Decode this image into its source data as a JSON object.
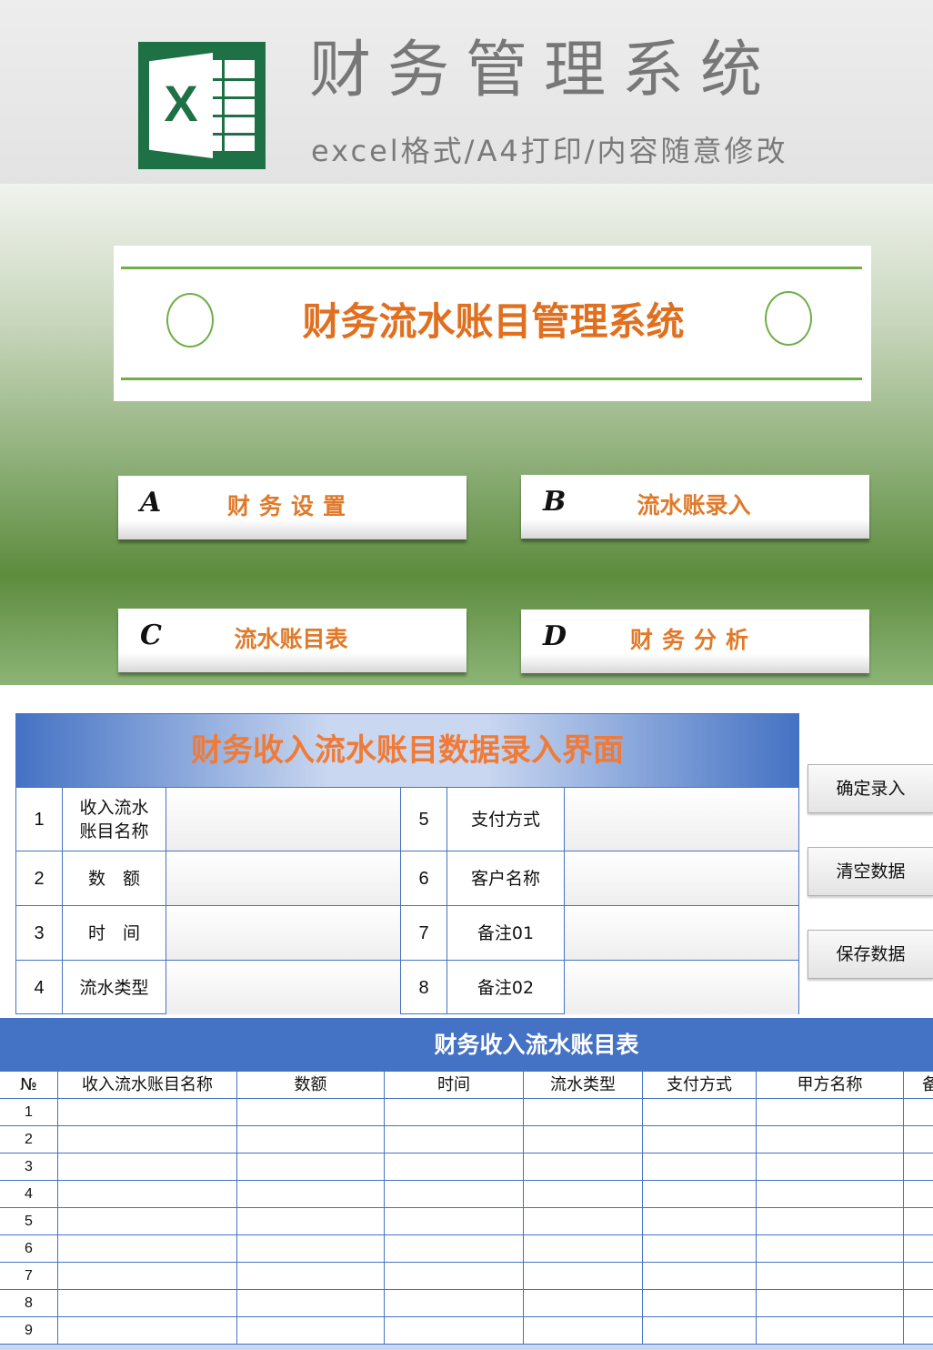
{
  "header": {
    "title": "财务管理系统",
    "subtitle": "excel格式/A4打印/内容随意修改",
    "logo_icon": "excel-logo-icon",
    "logo_letter": "X"
  },
  "banner": {
    "title": "财务流水账目管理系统"
  },
  "menu": [
    {
      "letter": "A",
      "label": "财务设置"
    },
    {
      "letter": "B",
      "label": "流水账录入"
    },
    {
      "letter": "C",
      "label": "流水账目表"
    },
    {
      "letter": "D",
      "label": "财务分析"
    }
  ],
  "form": {
    "title": "财务收入流水账目数据录入界面",
    "rows": [
      {
        "left_num": "1",
        "left_label": "收入流水\n账目名称",
        "left_value": "",
        "right_num": "5",
        "right_label": "支付方式",
        "right_value": ""
      },
      {
        "left_num": "2",
        "left_label": "数　额",
        "left_value": "",
        "right_num": "6",
        "right_label": "客户名称",
        "right_value": ""
      },
      {
        "left_num": "3",
        "left_label": "时　间",
        "left_value": "",
        "right_num": "7",
        "right_label": "备注01",
        "right_value": ""
      },
      {
        "left_num": "4",
        "left_label": "流水类型",
        "left_value": "",
        "right_num": "8",
        "right_label": "备注02",
        "right_value": ""
      }
    ],
    "buttons": {
      "confirm": "确定录入",
      "clear": "清空数据",
      "save": "保存数据"
    }
  },
  "table": {
    "title": "财务收入流水账目表",
    "columns": [
      "№",
      "收入流水账目名称",
      "数额",
      "时间",
      "流水类型",
      "支付方式",
      "甲方名称",
      "备"
    ],
    "rows": [
      "1",
      "2",
      "3",
      "4",
      "5",
      "6",
      "7",
      "8",
      "9"
    ]
  },
  "colors": {
    "accent_orange": "#e07020",
    "table_blue": "#4472c4",
    "excel_green": "#1e7145",
    "banner_green": "#6fae47"
  }
}
